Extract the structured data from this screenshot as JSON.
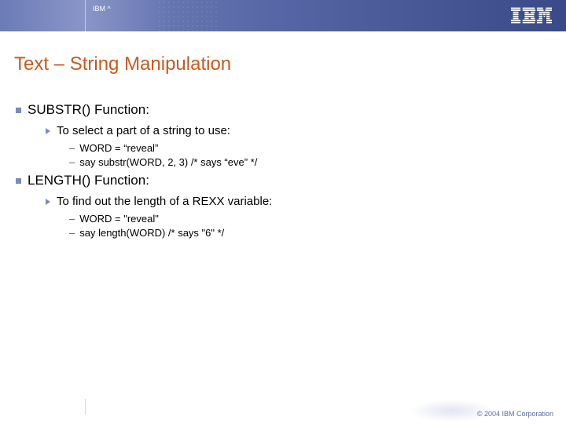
{
  "header": {
    "label": "IBM ^",
    "logo_name": "ibm-logo"
  },
  "title": "Text – String Manipulation",
  "sections": [
    {
      "heading": "SUBSTR() Function:",
      "sub": "To select a part of a string to use:",
      "lines": [
        "WORD = “reveal”",
        "say substr(WORD, 2, 3)  /* says “eve” */"
      ]
    },
    {
      "heading": "LENGTH() Function:",
      "sub": "To find out the length of a REXX variable:",
      "lines": [
        "WORD = \"reveal\"",
        "say length(WORD) /* says \"6\" */"
      ]
    }
  ],
  "footer": {
    "copyright": "© 2004 IBM Corporation"
  }
}
